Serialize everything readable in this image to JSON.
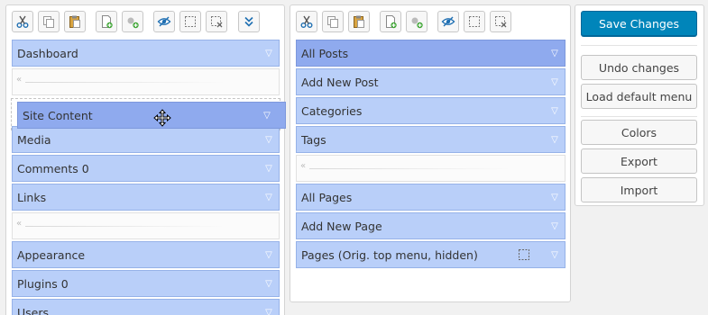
{
  "colors": {
    "accent": "#0085ba",
    "item": "#b9cff9",
    "item_selected": "#8faaee",
    "separator": "#fbfbfb"
  },
  "toolbar": {
    "cut_icon": "scissors-icon",
    "copy_icon": "copy-icon",
    "paste_icon": "paste-icon",
    "new_item_icon": "new-menu-icon",
    "new_separator_icon": "new-separator-icon",
    "hide_icon": "hide-icon",
    "select_icon": "select-icon",
    "delete_icon": "delete-icon",
    "expand_icon": "expand-all-icon"
  },
  "left_menu": {
    "items": [
      {
        "type": "item",
        "label": "Dashboard"
      },
      {
        "type": "placeholder"
      },
      {
        "type": "item",
        "label": "Media"
      },
      {
        "type": "item",
        "label": "Comments 0"
      },
      {
        "type": "item",
        "label": "Links"
      },
      {
        "type": "separator"
      },
      {
        "type": "item",
        "label": "Appearance"
      },
      {
        "type": "item",
        "label": "Plugins 0"
      },
      {
        "type": "item",
        "label": "Users"
      }
    ],
    "dragged_item": {
      "label": "Site Content"
    },
    "separator_top": {
      "glyph": "«"
    }
  },
  "right_menu": {
    "items": [
      {
        "label": "All Posts",
        "selected": true
      },
      {
        "label": "Add New Post"
      },
      {
        "label": "Categories"
      },
      {
        "label": "Tags"
      },
      {
        "label": "All Pages"
      },
      {
        "label": "Add New Page"
      },
      {
        "label": "Pages (Orig. top menu, hidden)"
      }
    ]
  },
  "actions": {
    "save": "Save Changes",
    "undo": "Undo changes",
    "load_default": "Load default menu",
    "colors": "Colors",
    "export": "Export",
    "import": "Import"
  }
}
